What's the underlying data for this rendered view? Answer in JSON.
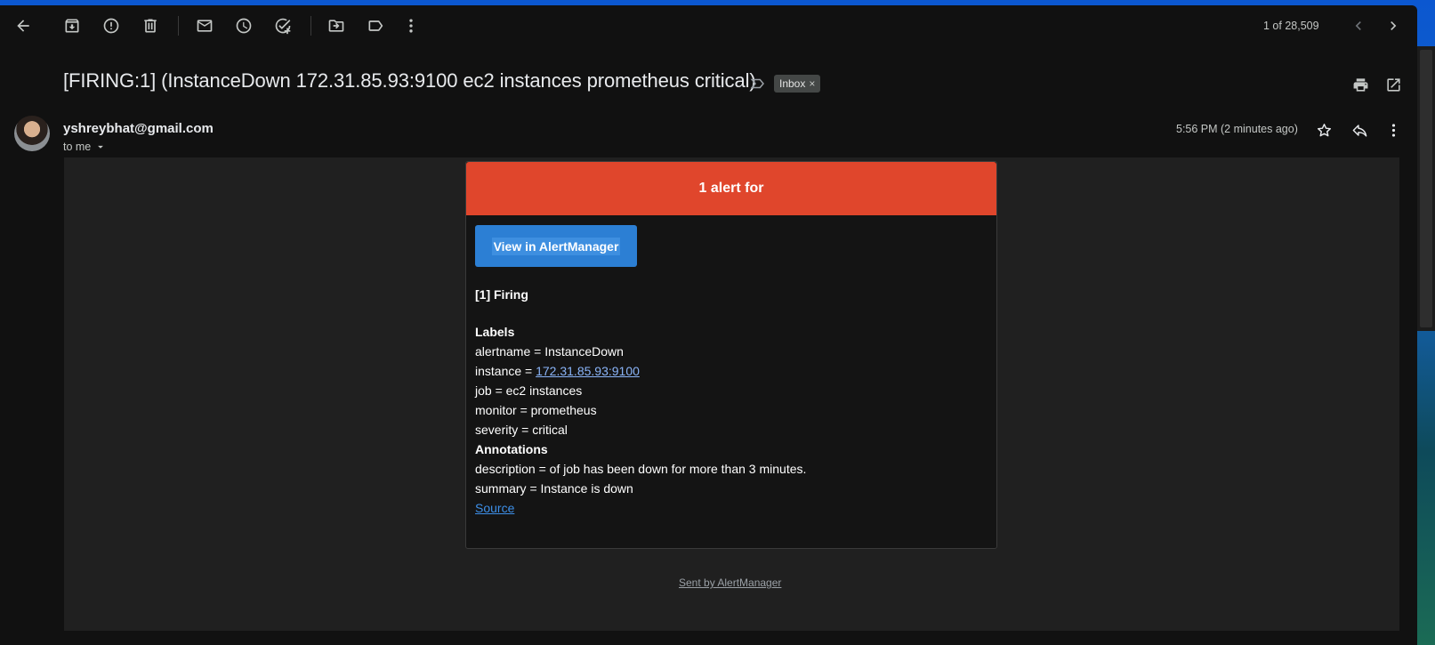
{
  "toolbar": {
    "back_icon": "arrow-left-icon",
    "archive_icon": "archive-icon",
    "report_spam_icon": "report-icon",
    "delete_icon": "trash-icon",
    "mark_unread_icon": "mail-icon",
    "snooze_icon": "clock-icon",
    "add_task_icon": "add-task-icon",
    "move_to_icon": "folder-move-icon",
    "labels_icon": "label-icon",
    "more_icon": "more-vert-icon",
    "pager_text": "1 of 28,509",
    "prev_icon": "chevron-left-icon",
    "next_icon": "chevron-right-icon"
  },
  "header": {
    "subject": "[FIRING:1] (InstanceDown 172.31.85.93:9100 ec2 instances prometheus critical)",
    "label": "Inbox",
    "label_remove": "×",
    "print_icon": "print-icon",
    "open_new_window_icon": "open-in-new-icon"
  },
  "message": {
    "sender": "yshreybhat@gmail.com",
    "recipient": "to me",
    "timestamp": "5:56 PM (2 minutes ago)",
    "star_icon": "star-icon",
    "reply_icon": "reply-icon",
    "more_icon": "more-vert-icon"
  },
  "email": {
    "header_text": "1 alert for",
    "button_label": "View in AlertManager",
    "firing_heading": "[1] Firing",
    "labels_heading": "Labels",
    "alertname": "alertname = InstanceDown",
    "instance_prefix": "instance = ",
    "instance_link": "172.31.85.93:9100",
    "job": "job = ec2 instances",
    "monitor": "monitor = prometheus",
    "severity": "severity = critical",
    "annotations_heading": "Annotations",
    "description": "description = of job has been down for more than 3 minutes.",
    "summary": "summary = Instance is down",
    "source_link": "Source",
    "footer_link": "Sent by AlertManager"
  },
  "colors": {
    "alert_header": "#e0462c",
    "button": "#2c7fd4",
    "background": "#111111"
  }
}
